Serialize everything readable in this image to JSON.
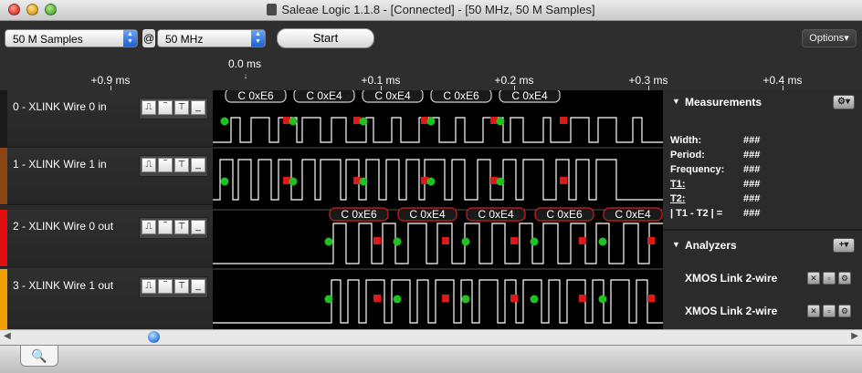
{
  "window": {
    "title": "Saleae Logic 1.1.8 - [Connected] - [50 MHz, 50 M Samples]"
  },
  "toolbar": {
    "samples": "50 M Samples",
    "at": "@",
    "rate": "50 MHz",
    "start_label": "Start",
    "options_label": "Options▾"
  },
  "ruler": {
    "zero": "0.0 ms",
    "labels": [
      "+0.9 ms",
      "+0.1 ms",
      "+0.2 ms",
      "+0.3 ms",
      "+0.4 ms"
    ]
  },
  "channels": [
    {
      "name": "0 - XLINK Wire 0 in",
      "color": "#1a1a1a"
    },
    {
      "name": "1 - XLINK Wire 1 in",
      "color": "#8b4513"
    },
    {
      "name": "2 - XLINK Wire 0 out",
      "color": "#e01010"
    },
    {
      "name": "3 - XLINK Wire 1 out",
      "color": "#f0a000"
    }
  ],
  "decode_labels_top": [
    "C 0xE6",
    "C 0xE4",
    "C 0xE4",
    "C 0xE6",
    "C 0xE4"
  ],
  "decode_labels_out": [
    "C 0xE6",
    "C 0xE4",
    "C 0xE4",
    "C 0xE6",
    "C 0xE4"
  ],
  "measurements": {
    "title": "Measurements",
    "rows": [
      {
        "label": "Width:",
        "value": "###"
      },
      {
        "label": "Period:",
        "value": "###"
      },
      {
        "label": "Frequency:",
        "value": "###"
      },
      {
        "label": "T1:",
        "value": "###"
      },
      {
        "label": "T2:",
        "value": "###"
      },
      {
        "label": "| T1 - T2 | =",
        "value": "###"
      }
    ]
  },
  "analyzers": {
    "title": "Analyzers",
    "add_label": "+▾",
    "items": [
      "XMOS Link 2-wire",
      "XMOS Link 2-wire"
    ]
  },
  "colors": {
    "marker_green": "#22c022",
    "marker_red": "#e01818",
    "accent_blue": "#2a6fdb"
  }
}
